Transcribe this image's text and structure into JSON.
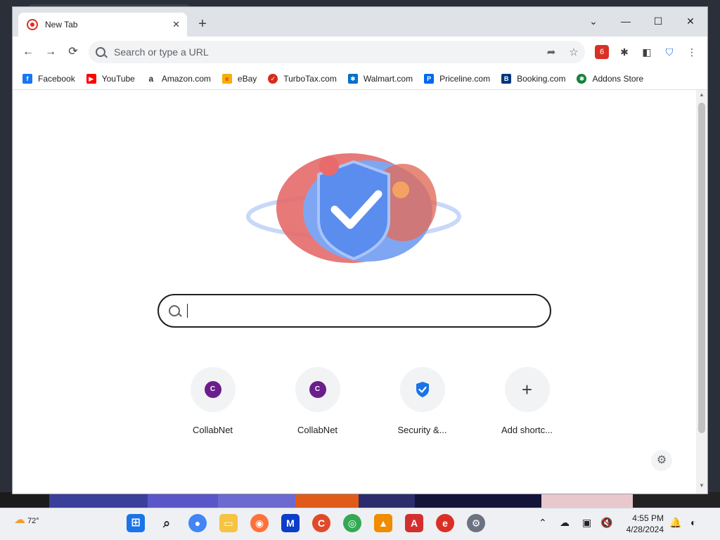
{
  "browser": {
    "tab": {
      "title": "New Tab",
      "close_glyph": "✕"
    },
    "new_tab_glyph": "+",
    "window_controls": {
      "dropdown": "⌄",
      "minimize": "—",
      "maximize": "☐",
      "close": "✕"
    },
    "nav": {
      "back": "←",
      "forward": "→",
      "reload": "⟳"
    },
    "omnibox": {
      "placeholder": "Search or type a URL",
      "share_icon": "share-icon",
      "star_icon": "star-icon"
    },
    "extensions": [
      "adblock-icon",
      "puzzle-icon",
      "sidepanel-icon",
      "shield-check-icon",
      "menu-icon"
    ],
    "bookmarks": [
      {
        "label": "Facebook",
        "icon": "f",
        "color": "#1877f2"
      },
      {
        "label": "YouTube",
        "icon": "▶",
        "color": "#ff0000"
      },
      {
        "label": "Amazon.com",
        "icon": "a",
        "color": "#232f3e"
      },
      {
        "label": "eBay",
        "icon": "e",
        "color": "#e53238"
      },
      {
        "label": "TurboTax.com",
        "icon": "✓",
        "color": "#d52b1e"
      },
      {
        "label": "Walmart.com",
        "icon": "✱",
        "color": "#0071ce"
      },
      {
        "label": "Priceline.com",
        "icon": "P",
        "color": "#0068ef"
      },
      {
        "label": "Booking.com",
        "icon": "B",
        "color": "#003580"
      },
      {
        "label": "Addons Store",
        "icon": "✱",
        "color": "#188038"
      }
    ]
  },
  "newtab": {
    "search": {
      "value": "",
      "placeholder": ""
    },
    "shortcuts": [
      {
        "label": "CollabNet",
        "icon": "C"
      },
      {
        "label": "CollabNet",
        "icon": "C"
      },
      {
        "label": "Security &...",
        "icon": "shield"
      },
      {
        "label": "Add shortc...",
        "icon": "+"
      }
    ],
    "customize_icon": "⚙"
  },
  "taskbar": {
    "weather": "72°",
    "time": "4:55 PM",
    "date": "4/28/2024",
    "apps": [
      "windows-start",
      "search",
      "browser",
      "file-explorer",
      "firefox",
      "malwarebytes",
      "ccleaner",
      "chrome",
      "vlc",
      "acrobat",
      "app-e",
      "settings"
    ]
  }
}
